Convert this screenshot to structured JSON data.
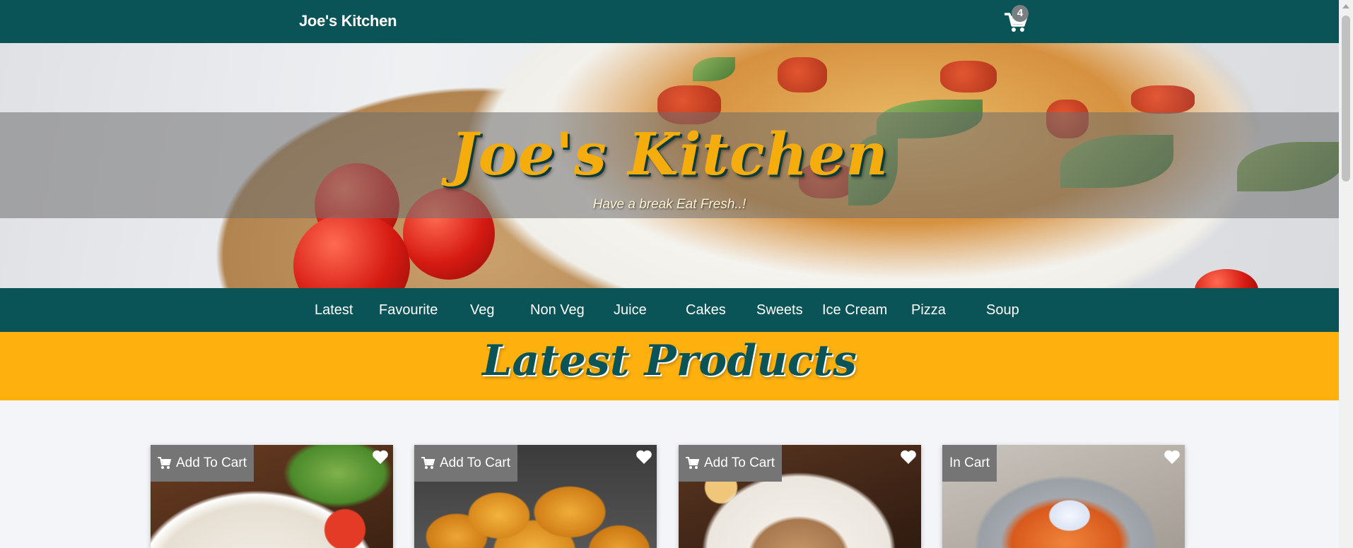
{
  "header": {
    "brand": "Joe's Kitchen",
    "cart_icon": "shopping-cart-icon",
    "cart_count": "4",
    "colors": {
      "bar": "#0a5357",
      "badge": "#7a7f82"
    }
  },
  "hero": {
    "title": "Joe's Kitchen",
    "subtitle": "Have a break Eat Fresh..!",
    "colors": {
      "title": "#f5ad0e"
    }
  },
  "categories": [
    "Latest",
    "Favourite",
    "Veg",
    "Non Veg",
    "Juice",
    "Cakes",
    "Sweets",
    "Ice Cream",
    "Pizza",
    "Soup"
  ],
  "section": {
    "title": "Latest Products",
    "colors": {
      "background": "#fdb00e",
      "title": "#0a5357"
    }
  },
  "products": [
    {
      "button": "Add To Cart",
      "cart_icon": "cart-icon",
      "favourite_icon": "heart-icon"
    },
    {
      "button": "Add To Cart",
      "cart_icon": "cart-icon",
      "favourite_icon": "heart-icon"
    },
    {
      "button": "Add To Cart",
      "cart_icon": "cart-icon",
      "favourite_icon": "heart-icon"
    },
    {
      "button": "In Cart",
      "favourite_icon": "heart-icon"
    }
  ]
}
